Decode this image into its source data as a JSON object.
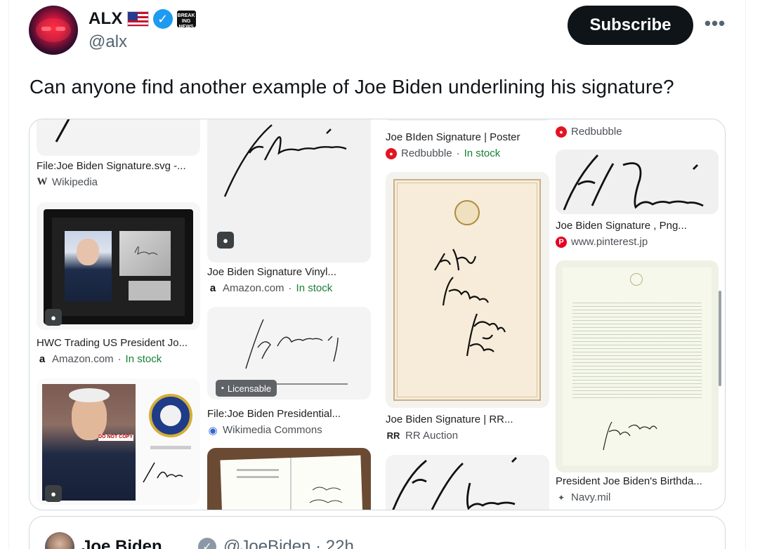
{
  "author": {
    "display_name": "ALX",
    "handle": "@alx",
    "verified": true,
    "affiliate_badge_text": "BREAKING NEWS"
  },
  "actions": {
    "subscribe_label": "Subscribe",
    "more_label": "•••"
  },
  "tweet": {
    "text": "Can anyone find another example of Joe Biden underlining his signature?"
  },
  "results": [
    {
      "title": "File:Joe Biden Signature.svg -...",
      "source": "Wikipedia",
      "stock": ""
    },
    {
      "title": "HWC Trading US President Jo...",
      "source": "Amazon.com",
      "stock": "In stock"
    },
    {
      "title": "Joe Biden Signature Vinyl...",
      "source": "Amazon.com",
      "stock": "In stock"
    },
    {
      "title": "File:Joe Biden Presidential...",
      "source": "Wikimedia Commons",
      "stock": "",
      "badge": "Licensable"
    },
    {
      "title": "Joe BIden Signature | Poster",
      "source": "Redbubble",
      "stock": "In stock"
    },
    {
      "title": "Joe Biden Signature | RR...",
      "source": "RR Auction",
      "stock": ""
    },
    {
      "title": "",
      "source": "Redbubble",
      "stock": ""
    },
    {
      "title": "Joe Biden Signature , Png...",
      "source": "www.pinterest.jp",
      "stock": ""
    },
    {
      "title": "President Joe Biden's Birthda...",
      "source": "Navy.mil",
      "stock": ""
    }
  ],
  "stock_separator": " · ",
  "quoted": {
    "display_name": "Joe Biden",
    "handle_time": "@JoeBiden · 22h"
  },
  "colors": {
    "accent_blue": "#1d9bf0",
    "in_stock_green": "#188038",
    "button_dark": "#0f1419",
    "muted_text": "#536471"
  }
}
